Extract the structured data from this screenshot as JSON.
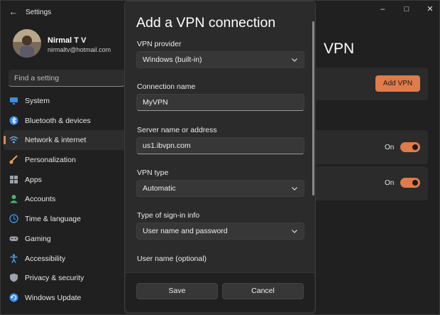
{
  "window": {
    "app_title": "Settings",
    "back_icon": "back-arrow-icon"
  },
  "account": {
    "name": "Nirmal T V",
    "email": "nirmaltv@hotmail.com"
  },
  "search": {
    "placeholder": "Find a setting"
  },
  "nav": {
    "items": [
      {
        "label": "System",
        "icon": "monitor-icon",
        "color": "#3b8ee6"
      },
      {
        "label": "Bluetooth & devices",
        "icon": "bluetooth-icon",
        "color": "#3b8ee6"
      },
      {
        "label": "Network & internet",
        "icon": "wifi-icon",
        "color": "#5aa9e6",
        "active": true
      },
      {
        "label": "Personalization",
        "icon": "brush-icon",
        "color": "#e09a5a"
      },
      {
        "label": "Apps",
        "icon": "apps-icon",
        "color": "#9ca3af"
      },
      {
        "label": "Accounts",
        "icon": "person-icon",
        "color": "#4ab56c"
      },
      {
        "label": "Time & language",
        "icon": "globe-clock-icon",
        "color": "#3b8ee6"
      },
      {
        "label": "Gaming",
        "icon": "gamepad-icon",
        "color": "#9ca3af"
      },
      {
        "label": "Accessibility",
        "icon": "accessibility-icon",
        "color": "#4aa3e6"
      },
      {
        "label": "Privacy & security",
        "icon": "shield-icon",
        "color": "#9ca3af"
      },
      {
        "label": "Windows Update",
        "icon": "update-icon",
        "color": "#3b8ee6"
      }
    ]
  },
  "main": {
    "title": "VPN",
    "add_vpn_label": "Add VPN",
    "toggle1_label": "On",
    "toggle2_label": "On",
    "accent": "#e07b4a"
  },
  "dialog": {
    "title": "Add a VPN connection",
    "provider_label": "VPN provider",
    "provider_value": "Windows (built-in)",
    "connection_label": "Connection name",
    "connection_value": "MyVPN",
    "server_label": "Server name or address",
    "server_value": "us1.ibvpn.com",
    "type_label": "VPN type",
    "type_value": "Automatic",
    "signin_label": "Type of sign-in info",
    "signin_value": "User name and password",
    "username_label": "User name (optional)",
    "save_label": "Save",
    "cancel_label": "Cancel"
  }
}
